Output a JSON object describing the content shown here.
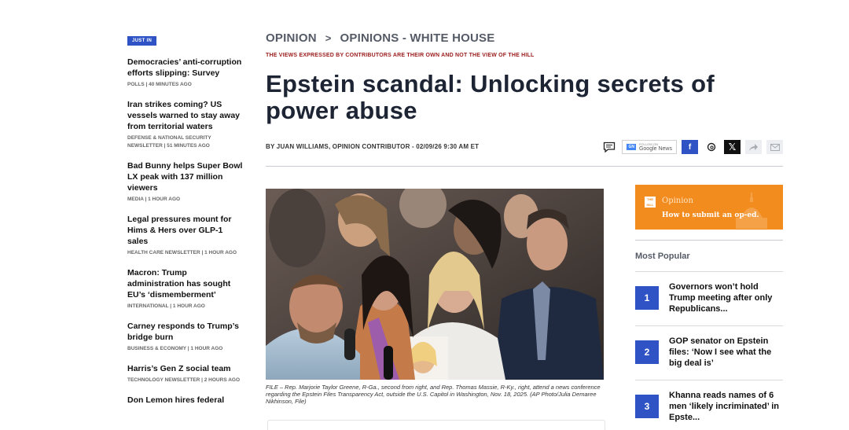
{
  "just_in": {
    "badge": "JUST IN",
    "items": [
      {
        "title": "Democracies’ anti-corruption efforts slipping: Survey",
        "meta": "POLLS | 40 MINUTES AGO"
      },
      {
        "title": "Iran strikes coming? US vessels warned to stay away from territorial waters",
        "meta": "DEFENSE & NATIONAL SECURITY NEWSLETTER | 51 MINUTES AGO"
      },
      {
        "title": "Bad Bunny helps Super Bowl LX peak with 137 million viewers",
        "meta": "MEDIA | 1 HOUR AGO"
      },
      {
        "title": "Legal pressures mount for Hims & Hers over GLP-1 sales",
        "meta": "HEALTH CARE NEWSLETTER | 1 HOUR AGO"
      },
      {
        "title": "Macron: Trump administration has sought EU’s ‘dismemberment’",
        "meta": "INTERNATIONAL | 1 HOUR AGO"
      },
      {
        "title": "Carney responds to Trump’s bridge burn",
        "meta": "BUSINESS & ECONOMY | 1 HOUR AGO"
      },
      {
        "title": "Harris’s Gen Z social team",
        "meta": "TECHNOLOGY NEWSLETTER | 2 HOURS AGO"
      },
      {
        "title": "Don Lemon hires federal",
        "meta": ""
      }
    ]
  },
  "breadcrumb": {
    "section": "OPINION",
    "separator": ">",
    "subsection": "OPINIONS - WHITE HOUSE"
  },
  "disclaimer": "THE VIEWS EXPRESSED BY CONTRIBUTORS ARE THEIR OWN AND NOT THE VIEW OF THE HILL",
  "headline": "Epstein scandal: Unlocking secrets of power abuse",
  "byline": "BY JUAN WILLIAMS, OPINION CONTRIBUTOR - 02/09/26 9:30 AM ET",
  "share": {
    "google_news_small": "FOLLOW ON",
    "google_news": "Google News",
    "facebook": "f",
    "x": "𝕏"
  },
  "caption": "FILE – Rep. Marjorie Taylor Greene, R-Ga., second from right, and Rep. Thomas Massie, R-Ky., right, attend a news conference regarding the Epstein Files Transparency Act, outside the U.S. Capitol in Washington, Nov. 18, 2025. (AP Photo/Julia Demaree Nikhinson, File)",
  "oped": {
    "logo": "THE HILL",
    "label": "Opinion",
    "link": "How to submit an op-ed."
  },
  "most_popular": {
    "title": "Most Popular",
    "items": [
      {
        "num": "1",
        "title": "Governors won’t hold Trump meeting after only Republicans..."
      },
      {
        "num": "2",
        "title": "GOP senator on Epstein files: ‘Now I see what the big deal is’"
      },
      {
        "num": "3",
        "title": "Khanna reads names of 6 men ‘likely incriminated’ in Epste..."
      }
    ]
  },
  "colors": {
    "accent": "#2f53c4",
    "oped": "#f28c1f",
    "disclaimer": "#9b1c1c"
  }
}
